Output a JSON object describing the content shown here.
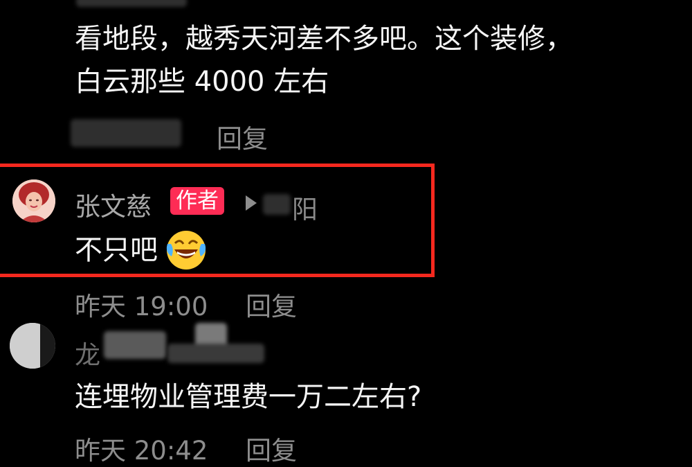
{
  "comment1": {
    "text_line1": "看地段，越秀天河差不多吧。这个装修，",
    "text_line2": "白云那些 4000 左右",
    "reply": "回复"
  },
  "comment2": {
    "author": "张文慈",
    "badge": "作者",
    "reply_target": "阳",
    "text": "不只吧",
    "emoji": "🤣",
    "time": "昨天 19:00",
    "reply": "回复"
  },
  "comment3": {
    "author": "龙",
    "text": "连埋物业管理费一万二左右?",
    "time": "昨天 20:42",
    "reply": "回复"
  },
  "colors": {
    "highlight": "#f5281e",
    "badge": "#fe2c55"
  }
}
